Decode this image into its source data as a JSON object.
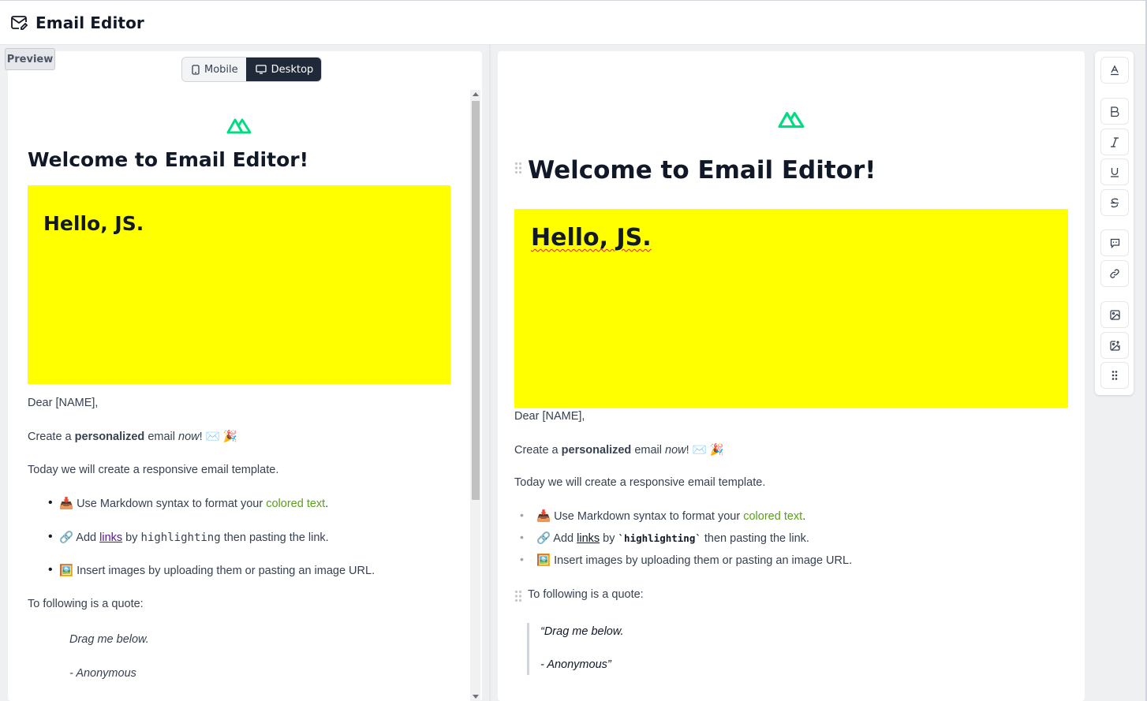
{
  "header": {
    "title": "Email Editor",
    "icon": "mail-edit-icon"
  },
  "preview": {
    "tag": "Preview",
    "device_options": [
      "Mobile",
      "Desktop"
    ],
    "active_device": "Desktop"
  },
  "email": {
    "heading": "Welcome to Email Editor!",
    "banner_text": "Hello, JS.",
    "banner_color": "#ffff00",
    "greeting": "Dear [NAME],",
    "line1": {
      "pre": "Create a ",
      "bold": "personalized",
      "mid": " email ",
      "italic": "now",
      "post": "! ✉️ 🎉"
    },
    "line2": "Today we will create a responsive email template.",
    "bullets": {
      "b1": {
        "pre": "📥 Use Markdown syntax to format your ",
        "colored": "colored text",
        "post": "."
      },
      "b2": {
        "pre": "🔗 Add ",
        "link": "links",
        "mid": " by ",
        "code": "highlighting",
        "code_editor": "`highlighting`",
        "post": " then pasting the link."
      },
      "b3": "🖼️ Insert images by uploading them or pasting an image URL."
    },
    "quote_intro": "To following is a quote:",
    "quote_line1": "Drag me below.",
    "quote_line2": "- Anonymous",
    "quote_line1_editor": "“Drag me below.",
    "quote_line2_editor": "- Anonymous”",
    "accent_color": "#00dc82"
  },
  "toolbar": {
    "buttons": [
      "text-style-icon",
      "bold-icon",
      "italic-icon",
      "underline-icon",
      "strikethrough-icon",
      "comment-icon",
      "link-icon",
      "image-icon",
      "image-upload-icon",
      "drag-handle-icon"
    ]
  }
}
